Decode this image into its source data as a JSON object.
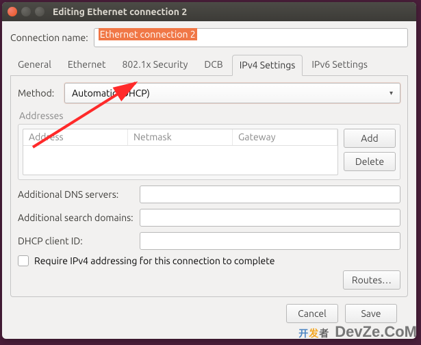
{
  "titlebar": {
    "title": "Editing Ethernet connection 2"
  },
  "connection_name": {
    "label": "Connection name:",
    "value": "Ethernet connection 2"
  },
  "tabs": {
    "general": "General",
    "ethernet": "Ethernet",
    "sec8021x": "802.1x Security",
    "dcb": "DCB",
    "ipv4": "IPv4 Settings",
    "ipv6": "IPv6 Settings"
  },
  "method": {
    "label": "Method:",
    "value": "Automatic (DHCP)"
  },
  "addresses": {
    "label": "Addresses",
    "cols": {
      "address": "Address",
      "netmask": "Netmask",
      "gateway": "Gateway"
    },
    "add": "Add",
    "delete": "Delete"
  },
  "fields": {
    "dns": "Additional DNS servers:",
    "search": "Additional search domains:",
    "dhcp_id": "DHCP client ID:",
    "dns_val": "",
    "search_val": "",
    "dhcp_id_val": ""
  },
  "require": {
    "label": "Require IPv4 addressing for this connection to complete",
    "checked": false
  },
  "routes": "Routes…",
  "footer": {
    "cancel": "Cancel",
    "save": "Save"
  },
  "watermark": {
    "site": "DevZe.CoM",
    "logo_pre": "开",
    "logo_mid": "发",
    "logo_suf": "者"
  }
}
